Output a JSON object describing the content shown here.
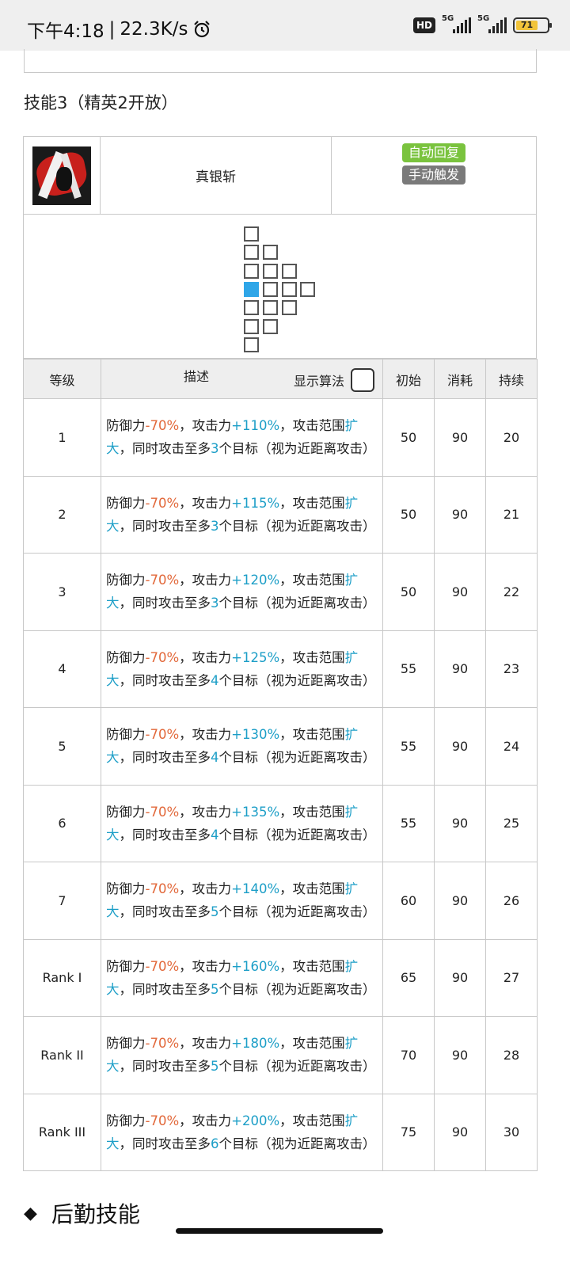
{
  "status_bar": {
    "time": "下午4:18",
    "speed": "22.3K/s",
    "hd_badge": "HD",
    "net1": "5G",
    "net2": "5G",
    "battery": "71"
  },
  "section": {
    "title": "技能3（精英2开放）"
  },
  "skill": {
    "name": "真银斩",
    "tags": [
      "自动回复",
      "手动触发"
    ]
  },
  "table": {
    "headers": {
      "level": "等级",
      "desc": "描述",
      "show_formula": "显示算法",
      "initial": "初始",
      "cost": "消耗",
      "duration": "持续"
    },
    "rows": [
      {
        "level": "1",
        "def": "-70%",
        "atk": "+110%",
        "targets": "3",
        "initial": "50",
        "cost": "90",
        "duration": "20"
      },
      {
        "level": "2",
        "def": "-70%",
        "atk": "+115%",
        "targets": "3",
        "initial": "50",
        "cost": "90",
        "duration": "21"
      },
      {
        "level": "3",
        "def": "-70%",
        "atk": "+120%",
        "targets": "3",
        "initial": "50",
        "cost": "90",
        "duration": "22"
      },
      {
        "level": "4",
        "def": "-70%",
        "atk": "+125%",
        "targets": "4",
        "initial": "55",
        "cost": "90",
        "duration": "23"
      },
      {
        "level": "5",
        "def": "-70%",
        "atk": "+130%",
        "targets": "4",
        "initial": "55",
        "cost": "90",
        "duration": "24"
      },
      {
        "level": "6",
        "def": "-70%",
        "atk": "+135%",
        "targets": "4",
        "initial": "55",
        "cost": "90",
        "duration": "25"
      },
      {
        "level": "7",
        "def": "-70%",
        "atk": "+140%",
        "targets": "5",
        "initial": "60",
        "cost": "90",
        "duration": "26"
      },
      {
        "level": "Rank I",
        "def": "-70%",
        "atk": "+160%",
        "targets": "5",
        "initial": "65",
        "cost": "90",
        "duration": "27"
      },
      {
        "level": "Rank II",
        "def": "-70%",
        "atk": "+180%",
        "targets": "5",
        "initial": "70",
        "cost": "90",
        "duration": "28"
      },
      {
        "level": "Rank III",
        "def": "-70%",
        "atk": "+200%",
        "targets": "6",
        "initial": "75",
        "cost": "90",
        "duration": "30"
      }
    ],
    "desc_parts": {
      "def_label": "防御力",
      "sep1": "，攻击力",
      "sep2": "，攻击范围",
      "expand_a": "扩",
      "expand_b": "大",
      "mid": "，同时攻击至多",
      "tail": "个目标（视为近距离攻击）"
    }
  },
  "next_section": {
    "title": "后勤技能"
  }
}
